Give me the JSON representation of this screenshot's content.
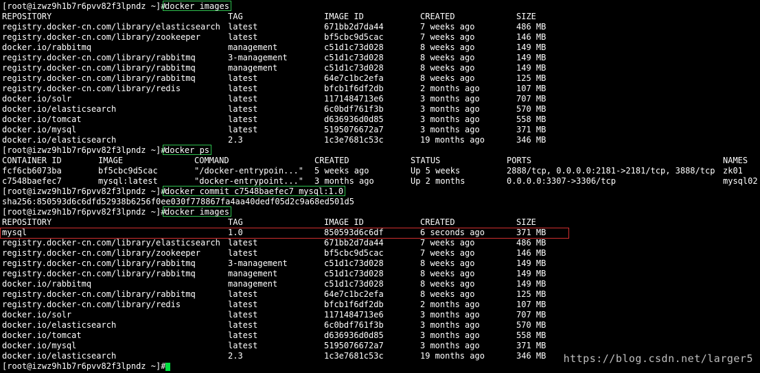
{
  "prompt": "[root@izwz9h1b7r6pvv82f3lpndz ~]#",
  "commands": {
    "images_1": "docker images",
    "ps": "docker ps",
    "commit": "docker commit c7548baefec7 mysql:1.0",
    "images_2": "docker images"
  },
  "commit_output": "sha256:850593d6c6dfd52938b6256f0ee030f778867fa4aa40dedf05d2c9a68ed501d5",
  "image_headers": [
    "REPOSITORY",
    "TAG",
    "IMAGE ID",
    "CREATED",
    "SIZE"
  ],
  "images_1": [
    [
      "registry.docker-cn.com/library/elasticsearch",
      "latest",
      "671bb2d7da44",
      "7 weeks ago",
      "486 MB"
    ],
    [
      "registry.docker-cn.com/library/zookeeper",
      "latest",
      "bf5cbc9d5cac",
      "7 weeks ago",
      "146 MB"
    ],
    [
      "docker.io/rabbitmq",
      "management",
      "c51d1c73d028",
      "8 weeks ago",
      "149 MB"
    ],
    [
      "registry.docker-cn.com/library/rabbitmq",
      "3-management",
      "c51d1c73d028",
      "8 weeks ago",
      "149 MB"
    ],
    [
      "registry.docker-cn.com/library/rabbitmq",
      "management",
      "c51d1c73d028",
      "8 weeks ago",
      "149 MB"
    ],
    [
      "registry.docker-cn.com/library/rabbitmq",
      "latest",
      "64e7c1bc2efa",
      "8 weeks ago",
      "125 MB"
    ],
    [
      "registry.docker-cn.com/library/redis",
      "latest",
      "bfcb1f6df2db",
      "2 months ago",
      "107 MB"
    ],
    [
      "docker.io/solr",
      "latest",
      "1171484713e6",
      "3 months ago",
      "707 MB"
    ],
    [
      "docker.io/elasticsearch",
      "latest",
      "6c0bdf761f3b",
      "3 months ago",
      "570 MB"
    ],
    [
      "docker.io/tomcat",
      "latest",
      "d636936d0d85",
      "3 months ago",
      "558 MB"
    ],
    [
      "docker.io/mysql",
      "latest",
      "5195076672a7",
      "3 months ago",
      "371 MB"
    ],
    [
      "docker.io/elasticsearch",
      "2.3",
      "1c3e7681c53c",
      "19 months ago",
      "346 MB"
    ]
  ],
  "ps_headers": [
    "CONTAINER ID",
    "IMAGE",
    "COMMAND",
    "CREATED",
    "STATUS",
    "PORTS",
    "NAMES"
  ],
  "containers": [
    [
      "fcf6cb6073ba",
      "bf5cbc9d5cac",
      "\"/docker-entrypoin...\"",
      "5 weeks ago",
      "Up 5 weeks",
      "2888/tcp, 0.0.0.0:2181->2181/tcp, 3888/tcp",
      "zk01"
    ],
    [
      "c7548baefec7",
      "mysql:latest",
      "\"docker-entrypoint...\"",
      "3 months ago",
      "Up 2 months",
      "0.0.0.0:3307->3306/tcp",
      "mysql02"
    ]
  ],
  "images_2": [
    [
      "mysql",
      "1.0",
      "850593d6c6df",
      "6 seconds ago",
      "371 MB"
    ],
    [
      "registry.docker-cn.com/library/elasticsearch",
      "latest",
      "671bb2d7da44",
      "7 weeks ago",
      "486 MB"
    ],
    [
      "registry.docker-cn.com/library/zookeeper",
      "latest",
      "bf5cbc9d5cac",
      "7 weeks ago",
      "146 MB"
    ],
    [
      "registry.docker-cn.com/library/rabbitmq",
      "3-management",
      "c51d1c73d028",
      "8 weeks ago",
      "149 MB"
    ],
    [
      "registry.docker-cn.com/library/rabbitmq",
      "management",
      "c51d1c73d028",
      "8 weeks ago",
      "149 MB"
    ],
    [
      "docker.io/rabbitmq",
      "management",
      "c51d1c73d028",
      "8 weeks ago",
      "149 MB"
    ],
    [
      "registry.docker-cn.com/library/rabbitmq",
      "latest",
      "64e7c1bc2efa",
      "8 weeks ago",
      "125 MB"
    ],
    [
      "registry.docker-cn.com/library/redis",
      "latest",
      "bfcb1f6df2db",
      "2 months ago",
      "107 MB"
    ],
    [
      "docker.io/solr",
      "latest",
      "1171484713e6",
      "3 months ago",
      "707 MB"
    ],
    [
      "docker.io/elasticsearch",
      "latest",
      "6c0bdf761f3b",
      "3 months ago",
      "570 MB"
    ],
    [
      "docker.io/tomcat",
      "latest",
      "d636936d0d85",
      "3 months ago",
      "558 MB"
    ],
    [
      "docker.io/mysql",
      "latest",
      "5195076672a7",
      "3 months ago",
      "371 MB"
    ],
    [
      "docker.io/elasticsearch",
      "2.3",
      "1c3e7681c53c",
      "19 months ago",
      "346 MB"
    ]
  ],
  "watermark": "https://blog.csdn.net/larger5",
  "colors": {
    "background": "#000000",
    "text": "#ffffff",
    "command_box": "#2fc24f",
    "highlight_box": "#d23030",
    "cursor": "#00e040"
  }
}
